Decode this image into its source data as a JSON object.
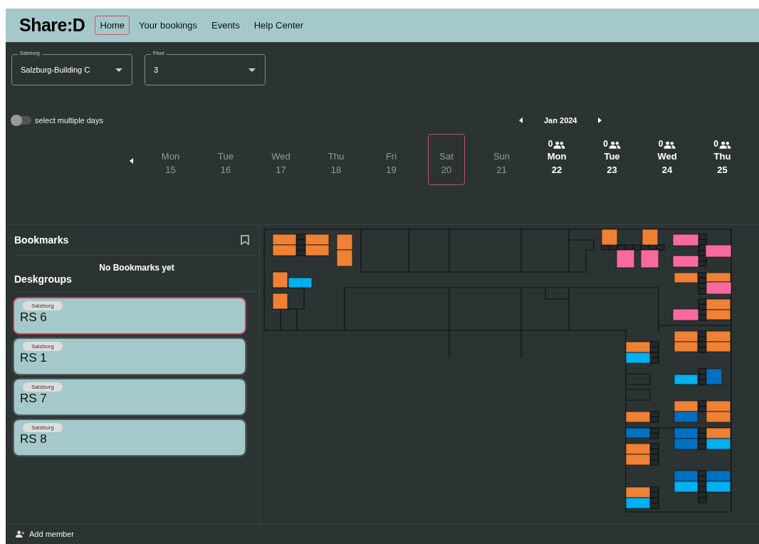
{
  "app": {
    "logo": "Share:D"
  },
  "nav": [
    {
      "label": "Home",
      "selected": true
    },
    {
      "label": "Your bookings",
      "selected": false
    },
    {
      "label": "Events",
      "selected": false
    },
    {
      "label": "Help Center",
      "selected": false
    }
  ],
  "selects": [
    {
      "label": "Salzburg",
      "value": "Salzburg-Building C"
    },
    {
      "label": "Floor",
      "value": "3"
    }
  ],
  "multi_day_toggle": {
    "label": "select multiple days",
    "on": false
  },
  "month": "Jan 2024",
  "days": [
    {
      "day": "Mon",
      "date": "15",
      "disabled": true,
      "selected": false
    },
    {
      "day": "Tue",
      "date": "16",
      "disabled": true,
      "selected": false
    },
    {
      "day": "Wed",
      "date": "17",
      "disabled": true,
      "selected": false
    },
    {
      "day": "Thu",
      "date": "18",
      "disabled": true,
      "selected": false
    },
    {
      "day": "Fri",
      "date": "19",
      "disabled": true,
      "selected": false
    },
    {
      "day": "Sat",
      "date": "20",
      "disabled": true,
      "selected": true
    },
    {
      "day": "Sun",
      "date": "21",
      "disabled": true,
      "selected": false
    },
    {
      "day": "Mon",
      "date": "22",
      "disabled": false,
      "selected": false,
      "count": "0"
    },
    {
      "day": "Tue",
      "date": "23",
      "disabled": false,
      "selected": false,
      "count": "0"
    },
    {
      "day": "Wed",
      "date": "24",
      "disabled": false,
      "selected": false,
      "count": "0"
    },
    {
      "day": "Thu",
      "date": "25",
      "disabled": false,
      "selected": false,
      "count": "0"
    }
  ],
  "bookmarks": {
    "title": "Bookmarks",
    "empty_text": "No Bookmarks yet"
  },
  "deskgroups": {
    "title": "Deskgroups",
    "items": [
      {
        "location": "Salzburg",
        "name": "RS 6",
        "selected": true
      },
      {
        "location": "Salzburg",
        "name": "RS 1",
        "selected": false
      },
      {
        "location": "Salzburg",
        "name": "RS 7",
        "selected": false
      },
      {
        "location": "Salzburg",
        "name": "RS 8",
        "selected": false
      }
    ]
  },
  "desks": [
    {
      "color": "#ee8133"
    },
    {
      "color": "#ee8133"
    },
    {
      "color": "#ee8133"
    },
    {
      "color": "#ee8133"
    },
    {
      "color": "#ee8133"
    },
    {
      "color": "#ee8133"
    },
    {
      "color": "#ee8133"
    },
    {
      "color": "#00b0f0"
    },
    {
      "color": "#ee8133"
    },
    {
      "color": "#ee8133"
    },
    {
      "color": "#ee8133"
    },
    {
      "color": "#f86a9e"
    },
    {
      "color": "#f86a9e"
    },
    {
      "color": "#f86a9e"
    },
    {
      "color": "#f86a9e"
    },
    {
      "color": "#f86a9e"
    },
    {
      "color": "#ee8133"
    },
    {
      "color": "#ee8133"
    },
    {
      "color": "#f86a9e"
    },
    {
      "color": "#ee8133"
    },
    {
      "color": "#ee8133"
    },
    {
      "color": "#f86a9e"
    },
    {
      "color": "#ee8133"
    },
    {
      "color": "#ee8133"
    },
    {
      "color": "#ee8133"
    },
    {
      "color": "#ee8133"
    },
    {
      "color": "#ee8133"
    },
    {
      "color": "#00b0f0"
    },
    {
      "color": "#00b0f0"
    },
    {
      "color": "#0070c0"
    },
    {
      "color": "#ee8133"
    },
    {
      "color": "#0070c0"
    },
    {
      "color": "#ee8133"
    },
    {
      "color": "#ee8133"
    },
    {
      "color": "#ee8133"
    },
    {
      "color": "#0070c0"
    },
    {
      "color": "#0070c0"
    },
    {
      "color": "#0070c0"
    },
    {
      "color": "#ee8133"
    },
    {
      "color": "#00b0f0"
    },
    {
      "color": "#ee8133"
    },
    {
      "color": "#ee8133"
    },
    {
      "color": "#0070c0"
    },
    {
      "color": "#00b0f0"
    },
    {
      "color": "#0070c0"
    },
    {
      "color": "#00b0f0"
    },
    {
      "color": "#ee8133"
    },
    {
      "color": "#00b0f0"
    }
  ],
  "footer": {
    "action": "Add member"
  }
}
